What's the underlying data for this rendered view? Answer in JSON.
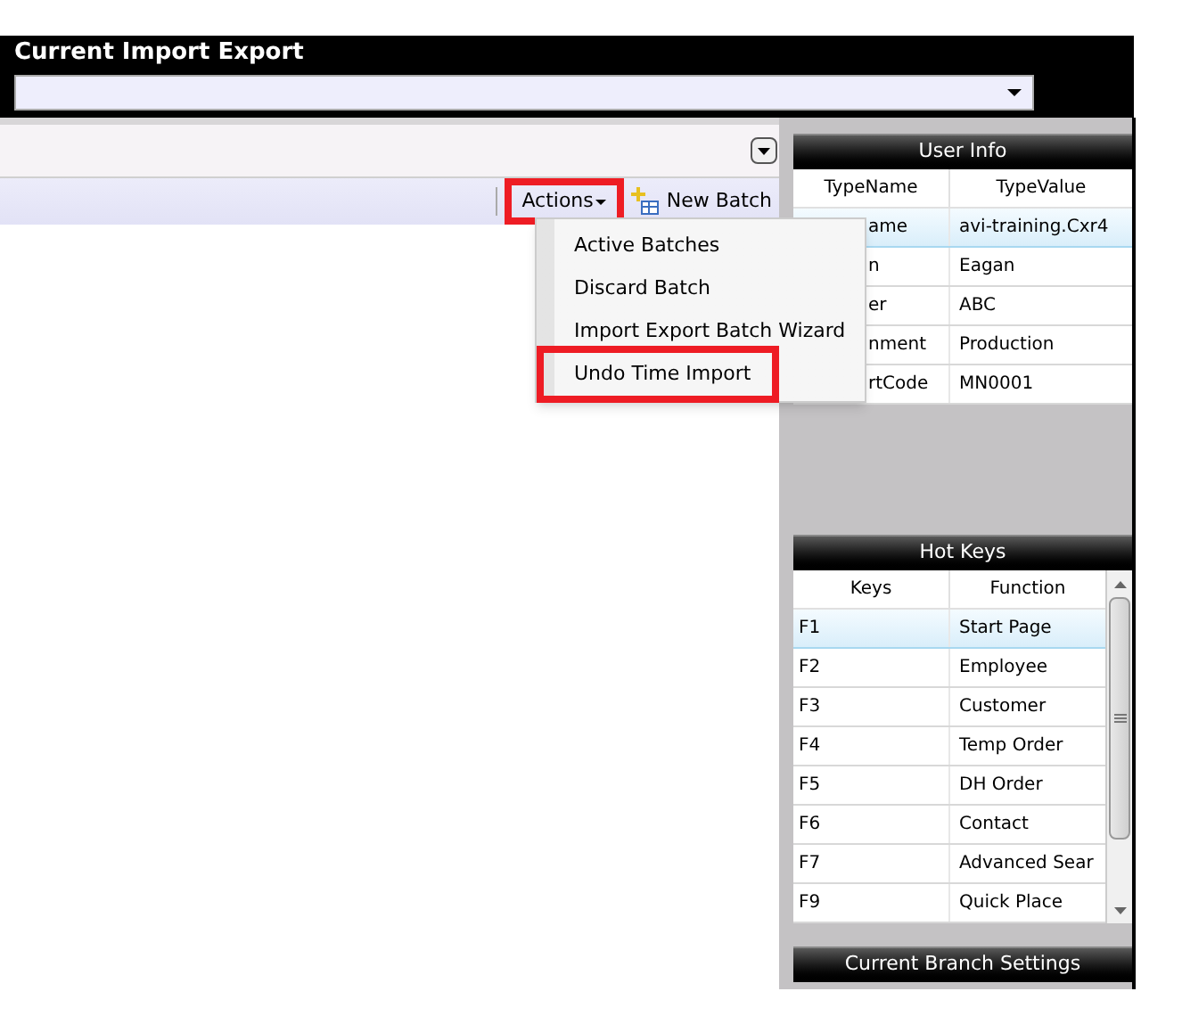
{
  "header": {
    "title": "Current Import Export"
  },
  "toolbar": {
    "actions": {
      "label": "Actions",
      "highlighted": true
    },
    "new_batch": {
      "label": "New Batch"
    }
  },
  "actions_menu": {
    "items": [
      {
        "label": "Active Batches",
        "highlighted": false
      },
      {
        "label": "Discard Batch",
        "highlighted": false
      },
      {
        "label": "Import Export Batch Wizard",
        "highlighted": false
      },
      {
        "label": "Undo Time Import",
        "highlighted": true
      }
    ]
  },
  "user_info": {
    "title": "User Info",
    "columns": [
      "TypeName",
      "TypeValue"
    ],
    "rows": [
      {
        "cells": [
          "ame",
          "avi-training.Cxr4"
        ],
        "selected": true
      },
      {
        "cells": [
          "n",
          "Eagan"
        ],
        "selected": false
      },
      {
        "cells": [
          "er",
          "ABC"
        ],
        "selected": false
      },
      {
        "cells": [
          "nment",
          "Production"
        ],
        "selected": false
      },
      {
        "cells": [
          "rtCode",
          "MN0001"
        ],
        "selected": false
      }
    ]
  },
  "hot_keys": {
    "title": "Hot Keys",
    "columns": [
      "Keys",
      "Function"
    ],
    "rows": [
      {
        "cells": [
          "F1",
          "Start Page"
        ],
        "selected": true
      },
      {
        "cells": [
          "F2",
          "Employee"
        ],
        "selected": false
      },
      {
        "cells": [
          "F3",
          "Customer"
        ],
        "selected": false
      },
      {
        "cells": [
          "F4",
          "Temp Order"
        ],
        "selected": false
      },
      {
        "cells": [
          "F5",
          "DH Order"
        ],
        "selected": false
      },
      {
        "cells": [
          "F6",
          "Contact"
        ],
        "selected": false
      },
      {
        "cells": [
          "F7",
          "Advanced Sear"
        ],
        "selected": false
      },
      {
        "cells": [
          "F9",
          "Quick Place"
        ],
        "selected": false
      }
    ]
  },
  "branch_settings": {
    "title": "Current Branch Settings"
  }
}
